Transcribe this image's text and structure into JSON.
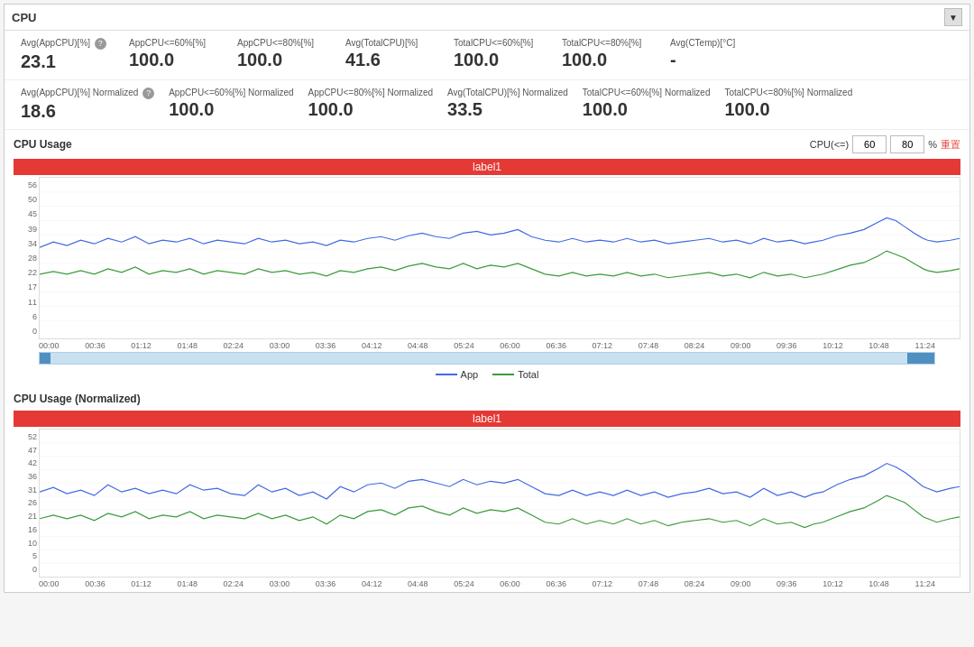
{
  "panel": {
    "title": "CPU",
    "collapse_icon": "▼"
  },
  "metrics_row1": [
    {
      "label": "Avg(AppCPU)[%]",
      "value": "23.1",
      "has_info": true
    },
    {
      "label": "AppCPU<=60%[%]",
      "value": "100.0",
      "has_info": false
    },
    {
      "label": "AppCPU<=80%[%]",
      "value": "100.0",
      "has_info": false
    },
    {
      "label": "Avg(TotalCPU)[%]",
      "value": "41.6",
      "has_info": false
    },
    {
      "label": "TotalCPU<=60%[%]",
      "value": "100.0",
      "has_info": false
    },
    {
      "label": "TotalCPU<=80%[%]",
      "value": "100.0",
      "has_info": false
    },
    {
      "label": "Avg(CTemp)[°C]",
      "value": "-",
      "has_info": false
    }
  ],
  "metrics_row2": [
    {
      "label": "Avg(AppCPU)[%] Normalized",
      "value": "18.6",
      "has_info": true
    },
    {
      "label": "AppCPU<=60%[%] Normalized",
      "value": "100.0",
      "has_info": false
    },
    {
      "label": "AppCPU<=80%[%] Normalized",
      "value": "100.0",
      "has_info": false
    },
    {
      "label": "Avg(TotalCPU)[%] Normalized",
      "value": "33.5",
      "has_info": false
    },
    {
      "label": "TotalCPU<=60%[%] Normalized",
      "value": "100.0",
      "has_info": false
    },
    {
      "label": "TotalCPU<=80%[%] Normalized",
      "value": "100.0",
      "has_info": false
    }
  ],
  "cpu_usage_section": {
    "title": "CPU Usage",
    "label1": "label1",
    "cpu_le_label": "CPU(<=)",
    "cpu_60": "60",
    "cpu_80": "80",
    "percent_label": "%",
    "reset_label": "重置",
    "y_axis": [
      "56",
      "50",
      "45",
      "39",
      "34",
      "28",
      "22",
      "17",
      "11",
      "6",
      "0"
    ],
    "x_axis": [
      "00:00",
      "00:36",
      "01:12",
      "01:48",
      "02:24",
      "03:00",
      "03:36",
      "04:12",
      "04:48",
      "05:24",
      "06:00",
      "06:36",
      "07:12",
      "07:48",
      "08:24",
      "09:00",
      "09:36",
      "10:12",
      "10:48",
      "11:24"
    ],
    "legend_app": "App",
    "legend_total": "Total"
  },
  "cpu_normalized_section": {
    "title": "CPU Usage (Normalized)",
    "label1": "label1",
    "y_axis": [
      "52",
      "47",
      "42",
      "36",
      "31",
      "26",
      "21",
      "16",
      "10",
      "5",
      "0"
    ],
    "x_axis": [
      "00:00",
      "00:36",
      "01:12",
      "01:48",
      "02:24",
      "03:00",
      "03:36",
      "04:12",
      "04:48",
      "05:24",
      "06:00",
      "06:36",
      "07:12",
      "07:48",
      "08:24",
      "09:00",
      "09:36",
      "10:12",
      "10:48",
      "11:24"
    ]
  },
  "colors": {
    "app_line": "#4169e1",
    "total_line": "#3a9a3a",
    "label_bar": "#e53935",
    "scrollbar": "#5090c0"
  }
}
